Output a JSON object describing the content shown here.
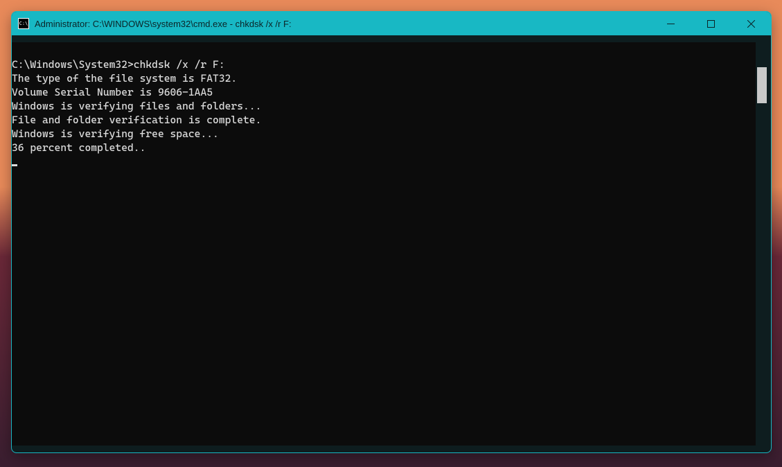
{
  "window": {
    "title": "Administrator: C:\\WINDOWS\\system32\\cmd.exe - chkdsk  /x /r F:"
  },
  "terminal": {
    "prompt": "C:\\Windows\\System32>",
    "command": "chkdsk /x /r F:",
    "lines": [
      "The type of the file system is FAT32.",
      "Volume Serial Number is 9606-1AA5",
      "Windows is verifying files and folders...",
      "File and folder verification is complete.",
      "Windows is verifying free space...",
      "36 percent completed.."
    ]
  }
}
